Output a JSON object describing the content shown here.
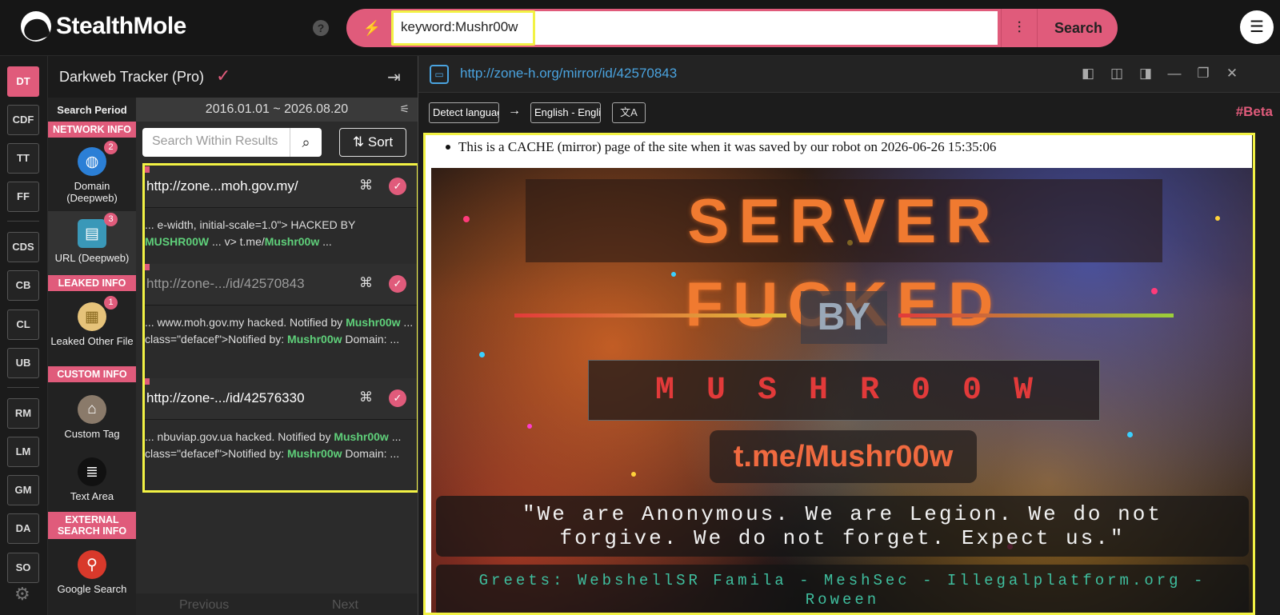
{
  "app": {
    "name": "StealthMole"
  },
  "search": {
    "query": "keyword:Mushr00w",
    "button_label": "Search"
  },
  "icons": {
    "bolt": "lightning-icon",
    "filter": "sliders-icon",
    "menu": "hamburger-icon",
    "help": "question-icon",
    "settings": "gear-icon"
  },
  "leftnav": {
    "items": [
      "DT",
      "CDF",
      "TT",
      "FF",
      "CDS",
      "CB",
      "CL",
      "UB",
      "RM",
      "LM",
      "GM",
      "DA",
      "SO"
    ],
    "active": "DT"
  },
  "panel": {
    "title": "Darkweb Tracker (Pro)",
    "search_period_label": "Search Period",
    "date_range": "2016.01.01 ~ 2026.08.20",
    "within_placeholder": "Search Within Results",
    "sort_label": "Sort",
    "pager": {
      "prev": "Previous",
      "next": "Next"
    }
  },
  "categories": {
    "network_info": "NETWORK INFO",
    "domain": {
      "label": "Domain (Deepweb)",
      "count": "2"
    },
    "url": {
      "label": "URL (Deepweb)",
      "count": "3"
    },
    "leaked_info": "LEAKED INFO",
    "leaked_other": {
      "label": "Leaked Other File",
      "count": "1"
    },
    "custom_info": "CUSTOM INFO",
    "custom_tag": {
      "label": "Custom Tag"
    },
    "text_area": {
      "label": "Text Area"
    },
    "external_info": "EXTERNAL SEARCH INFO",
    "google_search": {
      "label": "Google Search"
    }
  },
  "results": [
    {
      "title": "http://zone...moh.gov.my/",
      "snippet_a": "... e-width, initial-scale=1.0\"> HACKED BY ",
      "hit_1": "MUSHR00W",
      "snippet_b": " ... v> t.me/",
      "hit_2": "Mushr00w",
      "snippet_c": " ..."
    },
    {
      "title": "http://zone-.../id/42570843",
      "snippet_a": "... www.moh.gov.my hacked. Notified by ",
      "hit_1": "Mushr00w",
      "snippet_b": " ... class=\"defacef\">Notified by: ",
      "hit_2": "Mushr00w",
      "snippet_c": " Domain: ..."
    },
    {
      "title": "http://zone-.../id/42576330",
      "snippet_a": "... nbuviap.gov.ua hacked. Notified by ",
      "hit_1": "Mushr00w",
      "snippet_b": " ... class=\"defacef\">Notified by: ",
      "hit_2": "Mushr00w",
      "snippet_c": " Domain: ..."
    }
  ],
  "viewer": {
    "url": "http://zone-h.org/mirror/id/42570843",
    "detect_language": "Detect language",
    "target_language": "English - English",
    "beta": "#Beta",
    "cache_note": "This is a CACHE (mirror) page of the site when it was saved by our robot on 2026-06-26 15:35:06"
  },
  "deface": {
    "headline": "SERVER FUCKED",
    "by": "BY",
    "name": "MUSHR00W",
    "telegram": "t.me/Mushr00w",
    "quote_line1": "\"We are Anonymous. We are Legion. We do not",
    "quote_line2": "forgive. We do not forget. Expect us.\"",
    "greets": "Greets: WebshellSR Famila - MeshSec - Illegalplatform.org - Roween"
  },
  "colors": {
    "accent": "#e05b7b",
    "highlight": "#f2f244",
    "hit": "#5fd07a",
    "link": "#4aa3df"
  }
}
